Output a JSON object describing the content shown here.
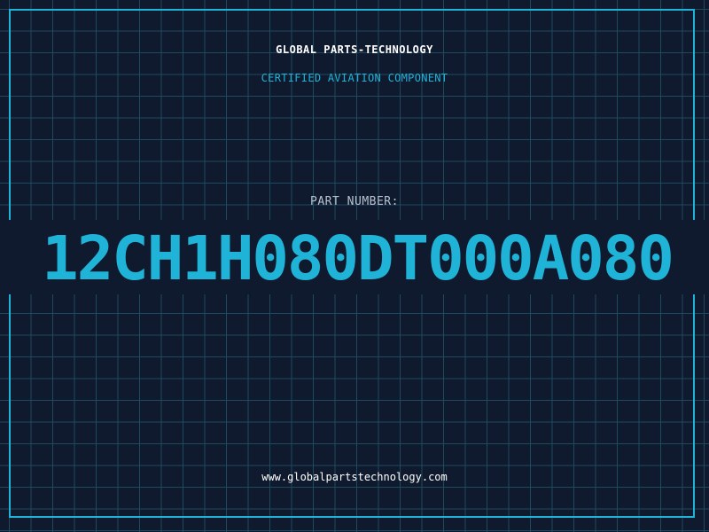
{
  "label": {
    "company": "GLOBAL PARTS-TECHNOLOGY",
    "subtitle": "CERTIFIED AVIATION COMPONENT",
    "part_number_label": "PART NUMBER:",
    "part_number": "12CH1H080DT000A080",
    "website": "www.globalpartstechnology.com"
  },
  "colors": {
    "background": "#101a2e",
    "grid": "#1e4a5e",
    "accent": "#1fb3d8",
    "text_primary": "#ffffff",
    "text_muted": "#b6c3cf"
  }
}
